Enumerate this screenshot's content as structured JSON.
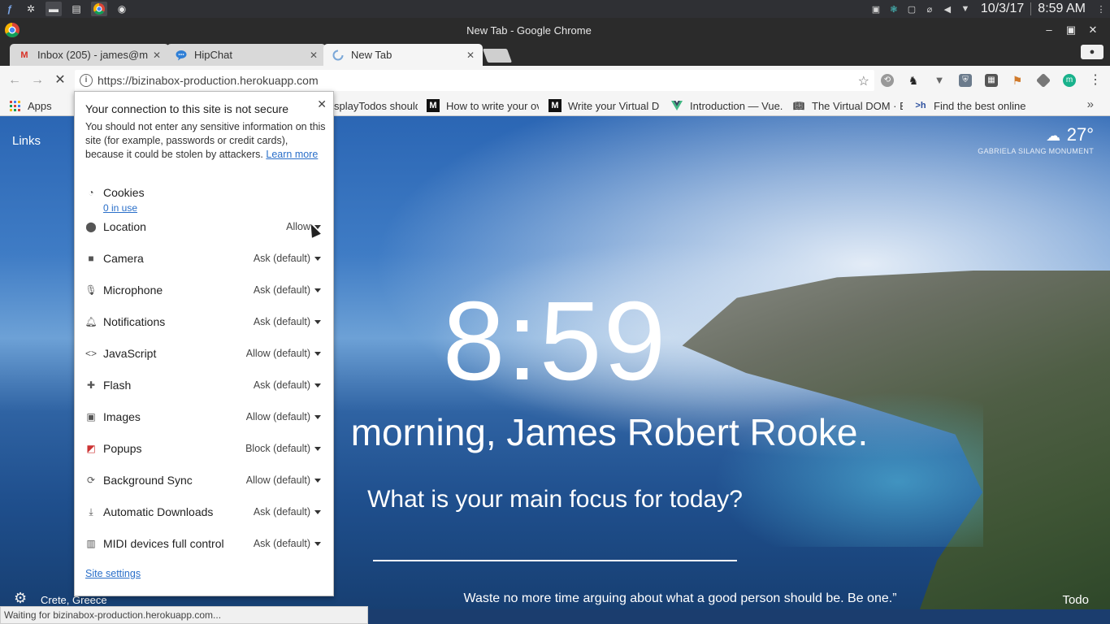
{
  "os_panel": {
    "date": "10/3/17",
    "time": "8:59 AM",
    "launchers": [
      "fedora-icon",
      "settings-icon",
      "terminal-icon",
      "files-icon",
      "chrome-icon",
      "app-icon"
    ],
    "tray": [
      "keyboard-icon",
      "network-icon",
      "screen-icon",
      "clip-icon",
      "volume-icon",
      "dropdown-icon"
    ]
  },
  "window": {
    "title": "New Tab - Google Chrome"
  },
  "tabs": [
    {
      "label": "Inbox (205) - james@m",
      "icon": "gmail-icon"
    },
    {
      "label": "HipChat",
      "icon": "hipchat-icon"
    },
    {
      "label": "New Tab",
      "icon": "loading-icon"
    }
  ],
  "omnibox": {
    "url": "https://bizinabox-production.herokuapp.com"
  },
  "bookmarks": [
    {
      "label": "Apps",
      "icon": "apps-grid-icon"
    },
    {
      "label": "splayTodos should",
      "icon": ""
    },
    {
      "label": "How to write your ov",
      "icon": "medium-icon"
    },
    {
      "label": "Write your Virtual DC",
      "icon": "medium-icon"
    },
    {
      "label": "Introduction — Vue.j",
      "icon": "vue-icon"
    },
    {
      "label": "The Virtual DOM · Bi",
      "icon": "book-icon"
    },
    {
      "label": "Find the best online",
      "icon": "hackr-icon"
    }
  ],
  "popup": {
    "title": "Your connection to this site is not secure",
    "description": "You should not enter any sensitive information on this site (for example, passwords or credit cards), because it could be stolen by attackers.",
    "learn_more": "Learn more",
    "cookies_label": "Cookies",
    "cookies_sub": "0 in use",
    "permissions": [
      {
        "label": "Location",
        "value": "Allow",
        "icon": "location-icon"
      },
      {
        "label": "Camera",
        "value": "Ask (default)",
        "icon": "camera-icon"
      },
      {
        "label": "Microphone",
        "value": "Ask (default)",
        "icon": "microphone-icon"
      },
      {
        "label": "Notifications",
        "value": "Ask (default)",
        "icon": "bell-icon"
      },
      {
        "label": "JavaScript",
        "value": "Allow (default)",
        "icon": "code-icon"
      },
      {
        "label": "Flash",
        "value": "Ask (default)",
        "icon": "puzzle-icon"
      },
      {
        "label": "Images",
        "value": "Allow (default)",
        "icon": "image-icon"
      },
      {
        "label": "Popups",
        "value": "Block (default)",
        "icon": "popup-icon"
      },
      {
        "label": "Background Sync",
        "value": "Allow (default)",
        "icon": "sync-icon"
      },
      {
        "label": "Automatic Downloads",
        "value": "Ask (default)",
        "icon": "download-icon"
      },
      {
        "label": "MIDI devices full control",
        "value": "Ask (default)",
        "icon": "midi-icon"
      }
    ],
    "site_settings": "Site settings"
  },
  "momentum": {
    "links": "Links",
    "temperature": "27°",
    "weather_location": "GABRIELA SILANG MONUMENT",
    "clock": "8:59",
    "greeting": "morning, James Robert Rooke.",
    "focus_question": "What is your main focus for today?",
    "location": "Crete, Greece",
    "quote": "Waste no more time arguing about what a good person should be. Be one.”",
    "todo": "Todo"
  },
  "status": "Waiting for bizinabox-production.herokuapp.com..."
}
